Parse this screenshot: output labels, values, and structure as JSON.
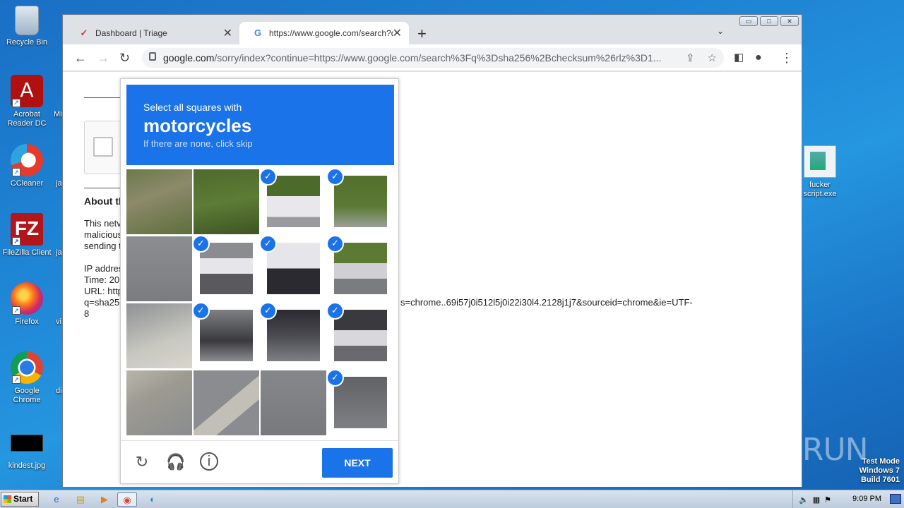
{
  "desktop": {
    "icons": [
      {
        "label": "Recycle Bin"
      },
      {
        "label": "Acrobat Reader DC"
      },
      {
        "label": "CCleaner"
      },
      {
        "label": "FileZilla Client"
      },
      {
        "label": "Firefox"
      },
      {
        "label": "Google Chrome"
      },
      {
        "label": "kindest.jpg"
      },
      {
        "label": "fucker script.exe"
      }
    ],
    "partial_labels": [
      "Mi",
      "ja",
      "ja",
      "vi",
      "di"
    ]
  },
  "browser": {
    "tabs": [
      {
        "label": "Dashboard | Triage",
        "active": false
      },
      {
        "label": "https://www.google.com/search?q=",
        "active": true
      }
    ],
    "new_tab": "+",
    "url_host": "google.com",
    "url_rest": "/sorry/index?continue=https://www.google.com/search%3Fq%3Dsha256%2Bchecksum%26rlz%3D1...",
    "window_controls": [
      "▭",
      "□",
      "✕"
    ]
  },
  "page": {
    "about_heading": "About th",
    "para_line1": "This netv",
    "para_line2": "malicious",
    "para_line3": "sending t",
    "ip_label": "IP addres",
    "time_label": "Time: 20",
    "url_label": "URL: http",
    "url_line2_start": "q=sha256",
    "url_line2_end": "s=chrome..69i57j0i512l5j0i22i30l4.2128j1j7&sourceid=chrome&ie=UTF-",
    "url_line3": "8"
  },
  "captcha": {
    "instruction": "Select all squares with",
    "target": "motorcycles",
    "hint": "If there are none, click skip",
    "selected": [
      false,
      false,
      true,
      true,
      false,
      true,
      true,
      true,
      false,
      true,
      true,
      true,
      false,
      false,
      false,
      true
    ],
    "next_label": "NEXT"
  },
  "watermark": "ANY RUN",
  "system": {
    "line1": "Test Mode",
    "line2": "Windows 7",
    "line3": "Build 7601"
  },
  "taskbar": {
    "start_label": "Start",
    "clock": "9:09 PM"
  },
  "colors": {
    "accent": "#1a73e8",
    "desktop": "#1f86d6"
  }
}
